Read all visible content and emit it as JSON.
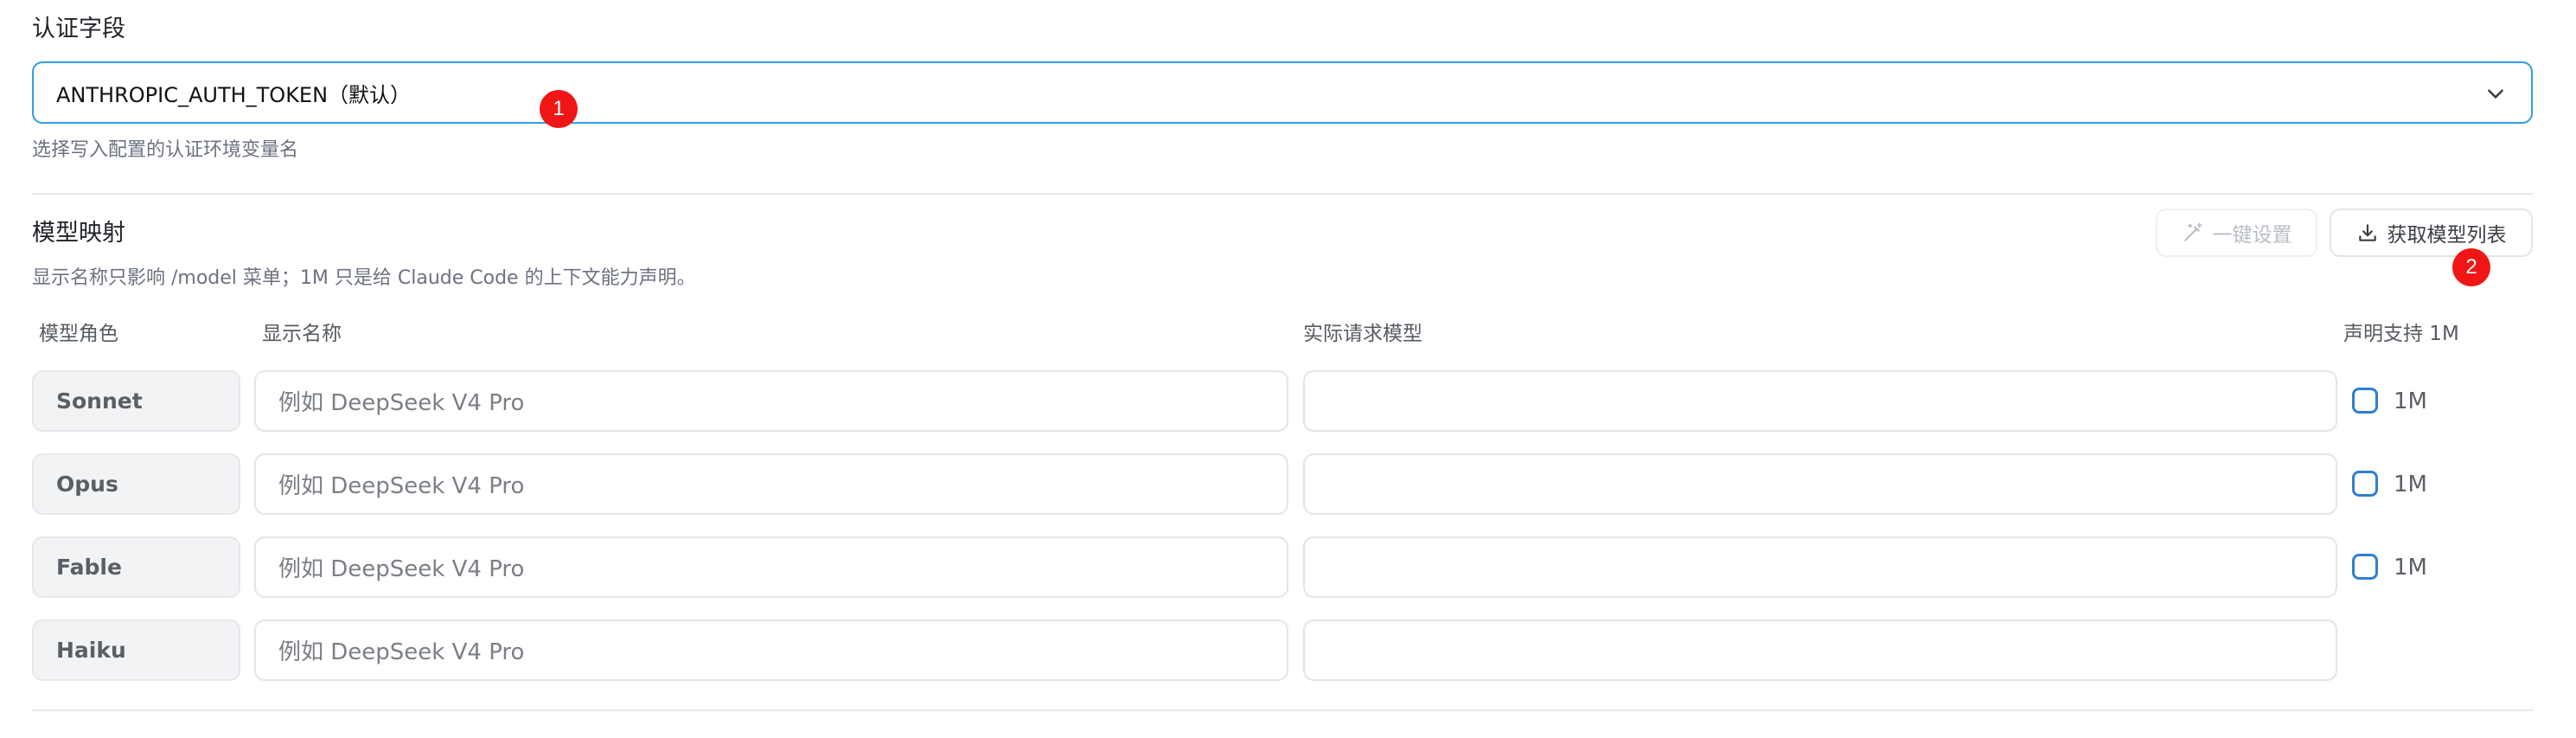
{
  "auth": {
    "label": "认证字段",
    "selected_value": "ANTHROPIC_AUTH_TOKEN（默认）",
    "hint": "选择写入配置的认证环境变量名",
    "dropdown_icon": "chevron-down-icon"
  },
  "mapping": {
    "title": "模型映射",
    "description": "显示名称只影响 /model 菜单；1M 只是给 Claude Code 的上下文能力声明。",
    "one_click_button": "一键设置",
    "one_click_icon": "magic-wand-icon",
    "fetch_button": "获取模型列表",
    "fetch_icon": "download-icon",
    "columns": {
      "role": "模型角色",
      "display_name": "显示名称",
      "actual_model": "实际请求模型",
      "declare_1m": "声明支持 1M"
    },
    "rows": [
      {
        "role": "Sonnet",
        "display_placeholder": "例如 DeepSeek V4 Pro",
        "actual_value": "",
        "has_1m": true,
        "checked": false,
        "check_label": "1M"
      },
      {
        "role": "Opus",
        "display_placeholder": "例如 DeepSeek V4 Pro",
        "actual_value": "",
        "has_1m": true,
        "checked": false,
        "check_label": "1M"
      },
      {
        "role": "Fable",
        "display_placeholder": "例如 DeepSeek V4 Pro",
        "actual_value": "",
        "has_1m": true,
        "checked": false,
        "check_label": "1M"
      },
      {
        "role": "Haiku",
        "display_placeholder": "例如 DeepSeek V4 Pro",
        "actual_value": "",
        "has_1m": false
      }
    ]
  },
  "annotations": {
    "badge_1": "1",
    "badge_2": "2"
  },
  "colors": {
    "accent": "#2f9de4",
    "badge": "#f01616",
    "checkbox": "#2f7fd0"
  }
}
